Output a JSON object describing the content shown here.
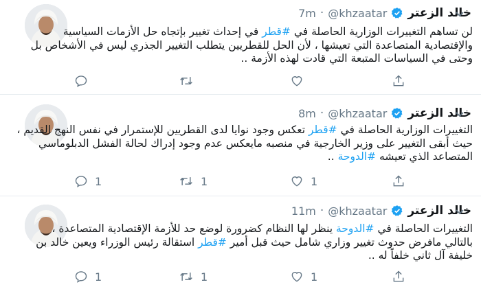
{
  "tweets": [
    {
      "name": "خالد الزعتر",
      "handle": "@khzaatar",
      "sep": "·",
      "time": "7m",
      "lines": [
        [
          {
            "t": "لن تساهم التغييرات الوزارية الحاصلة في "
          },
          {
            "t": "#قطر",
            "h": true
          },
          {
            "t": " في إحداث تغيير بإتجاه حل الأزمات السياسية"
          }
        ],
        [
          {
            "t": "والإقتصادية المتصاعدة التي تعيشها ، لأن الحل للقطريين يتطلب التغيير الجذري ليس في الأشخاص بل"
          }
        ],
        [
          {
            "t": "وحتى في السياسات المتبعة التي قادت لهذه الأزمة .."
          }
        ]
      ],
      "counts": {
        "reply": "",
        "retweet": "",
        "like": ""
      }
    },
    {
      "name": "خالد الزعتر",
      "handle": "@khzaatar",
      "sep": "·",
      "time": "8m",
      "lines": [
        [
          {
            "t": "التغييرات الوزارية الحاصلة في "
          },
          {
            "t": "#قطر",
            "h": true
          },
          {
            "t": " تعكس وجود نوايا لدى القطريين للإستمرار في نفس النهج القديم ،"
          }
        ],
        [
          {
            "t": "حيث أبقى التغيير على وزير الخارجية في منصبه مايعكس عدم وجود إدراك لحالة الفشل الدبلوماسي"
          }
        ],
        [
          {
            "t": "المتصاعد الذي تعيشه "
          },
          {
            "t": "#الدوحة",
            "h": true
          },
          {
            "t": " .."
          }
        ]
      ],
      "counts": {
        "reply": "1",
        "retweet": "1",
        "like": "1"
      }
    },
    {
      "name": "خالد الزعتر",
      "handle": "@khzaatar",
      "sep": "·",
      "time": "11m",
      "lines": [
        [
          {
            "t": "التغييرات الحاصلة في "
          },
          {
            "t": "#الدوحة",
            "h": true
          },
          {
            "t": " ينظر لها النظام كضرورة لوضع حد للأزمة الإقتصادية المتصاعدة ،"
          }
        ],
        [
          {
            "t": "بالتالي مافرض حدوث تغيير وزاري شامل حيث قبل أمير "
          },
          {
            "t": "#قطر",
            "h": true
          },
          {
            "t": " استقالة رئيس الوزراء ويعين خالد بن"
          }
        ],
        [
          {
            "t": "خليفة آل ثاني خلفاً له .."
          }
        ]
      ],
      "counts": {
        "reply": "1",
        "retweet": "1",
        "like": "1"
      }
    }
  ],
  "colors": {
    "hashtag": "#1da1f2",
    "verified": "#1da1f2",
    "muted": "#657786"
  },
  "icons": {
    "reply": "reply-icon",
    "retweet": "retweet-icon",
    "like": "like-icon",
    "share": "share-icon",
    "verified": "verified-badge-icon",
    "caret": "chevron-down-icon"
  }
}
